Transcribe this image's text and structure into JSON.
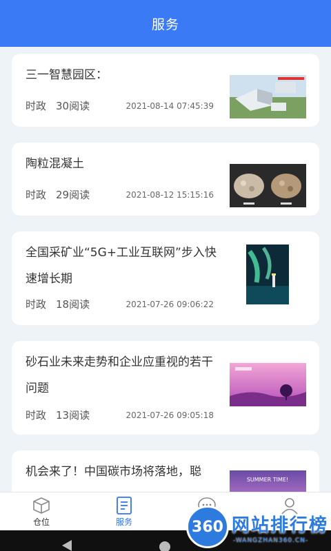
{
  "header": {
    "title": "服务"
  },
  "articles": [
    {
      "title": "三一智慧园区：",
      "category": "时政",
      "views": "30阅读",
      "time": "2021-08-14 07:45:39",
      "image": "industrial-park-photo"
    },
    {
      "title": "陶粒混凝土",
      "category": "时政",
      "views": "29阅读",
      "time": "2021-08-12 15:15:16",
      "image": "ceramsite-photo"
    },
    {
      "title": "全国采矿业“5G+工业互联网”步入快速增长期",
      "category": "时政",
      "views": "18阅读",
      "time": "2021-07-26 09:06:22",
      "image": "aurora-lighthouse-photo"
    },
    {
      "title": "砂石业未来走势和企业应重视的若干问题",
      "category": "时政",
      "views": "13阅读",
      "time": "2021-07-26 09:05:18",
      "image": "pink-sunset-illustration"
    },
    {
      "title": "机会来了！中国碳市场将落地，聪",
      "image": "summer-poster-illustration",
      "image_text": "SUMMER TIME!"
    }
  ],
  "tabs": [
    {
      "label": "仓位",
      "icon": "box-icon"
    },
    {
      "label": "服务",
      "icon": "document-icon",
      "active": true
    },
    {
      "label": "",
      "icon": "chat-icon"
    },
    {
      "label": "",
      "icon": "person-icon"
    }
  ],
  "watermark": {
    "logo": "360",
    "text": "网站排行榜",
    "url": "-WANGZHAN360.CN-"
  },
  "colors": {
    "primary": "#3a7bf5",
    "background": "#eef3f8"
  }
}
